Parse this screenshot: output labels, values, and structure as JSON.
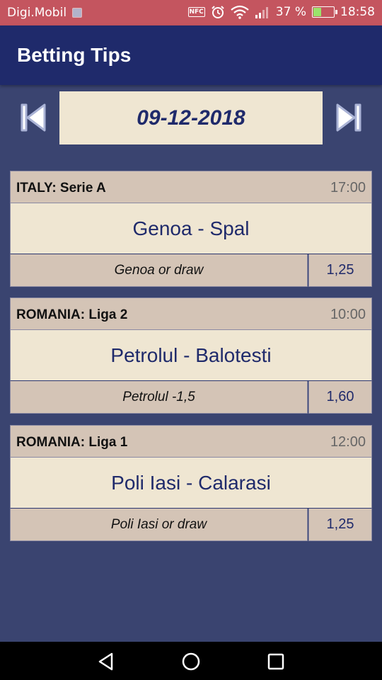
{
  "status_bar": {
    "carrier": "Digi.Mobil",
    "nfc": "NFC",
    "battery_text": "37 %",
    "battery_level": 0.37,
    "time": "18:58",
    "icons": [
      "image-notification-icon",
      "nfc-icon",
      "alarm-icon",
      "wifi-icon",
      "signal-icon",
      "battery-charging-icon"
    ]
  },
  "app_bar": {
    "title": "Betting Tips"
  },
  "date_nav": {
    "date": "09-12-2018",
    "prev_icon": "skip-previous-icon",
    "next_icon": "skip-next-icon"
  },
  "matches": [
    {
      "league": "ITALY: Serie A",
      "time": "17:00",
      "match": "Genoa - Spal",
      "tip": "Genoa or draw",
      "odds": "1,25"
    },
    {
      "league": "ROMANIA: Liga 2",
      "time": "10:00",
      "match": "Petrolul - Balotesti",
      "tip": "Petrolul -1,5",
      "odds": "1,60"
    },
    {
      "league": "ROMANIA: Liga 1",
      "time": "12:00",
      "match": "Poli Iasi - Calarasi",
      "tip": "Poli Iasi or draw",
      "odds": "1,25"
    }
  ],
  "system_nav": {
    "back_icon": "back-triangle-icon",
    "home_icon": "home-circle-icon",
    "recents_icon": "recents-square-icon"
  },
  "colors": {
    "status_bar": "#c4555f",
    "app_bar": "#1f2a6b",
    "background": "#3a4470",
    "card_light": "#efe6d2",
    "card_dark": "#d4c4b6",
    "accent_text": "#1f2a6b"
  }
}
